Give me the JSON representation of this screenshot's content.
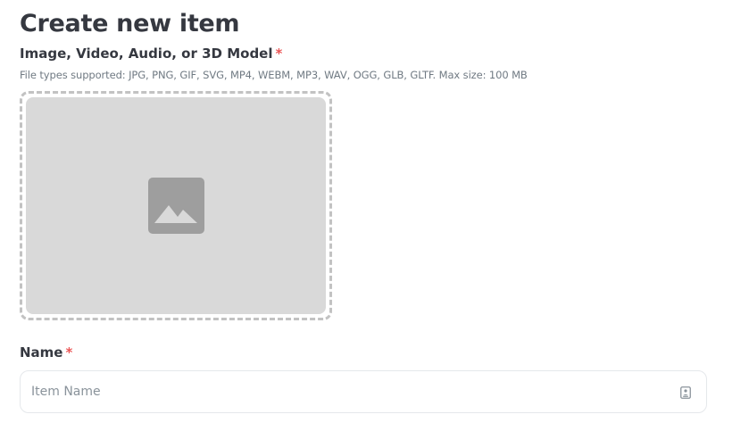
{
  "page": {
    "title": "Create new item"
  },
  "media": {
    "label": "Image, Video, Audio, or 3D Model",
    "required_mark": "*",
    "help_text": "File types supported: JPG, PNG, GIF, SVG, MP4, WEBM, MP3, WAV, OGG, GLB, GLTF. Max size: 100 MB",
    "icon": "image-placeholder-icon"
  },
  "name": {
    "label": "Name",
    "required_mark": "*",
    "placeholder": "Item Name",
    "value": "",
    "icon": "autofill-contact-icon"
  },
  "colors": {
    "text": "#353840",
    "muted": "#707a83",
    "required": "#eb5757",
    "dropzone_fill": "#d9d9d9",
    "dropzone_border": "#c2c2c2",
    "icon_fill": "#9e9e9e"
  }
}
